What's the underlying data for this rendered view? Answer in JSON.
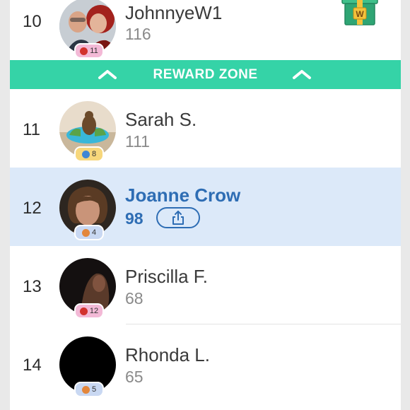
{
  "leaderboard": {
    "reward_zone_label": "REWARD ZONE",
    "rows": [
      {
        "rank": "10",
        "name": "JohnnyeW1",
        "score": "116",
        "level": "11",
        "badge_color": "#f3b9d6",
        "badge_icon": "red-game-icon"
      },
      {
        "rank": "11",
        "name": "Sarah S.",
        "score": "111",
        "level": "8",
        "badge_color": "#f7d77b",
        "badge_icon": "blue-game-icon"
      },
      {
        "rank": "12",
        "name": "Joanne Crow",
        "score": "98",
        "level": "4",
        "badge_color": "#c9d8f2",
        "badge_icon": "orange-game-icon",
        "is_current_user": true
      },
      {
        "rank": "13",
        "name": "Priscilla F.",
        "score": "68",
        "level": "12",
        "badge_color": "#f3b9d6",
        "badge_icon": "red-game-icon"
      },
      {
        "rank": "14",
        "name": "Rhonda L.",
        "score": "65",
        "level": "5",
        "badge_color": "#c9d8f2",
        "badge_icon": "orange-game-icon"
      }
    ],
    "gift_letter": "W"
  },
  "colors": {
    "reward_zone": "#35d3a7",
    "current_user_bg": "#dce9f9",
    "current_user_text": "#2e6db4"
  }
}
